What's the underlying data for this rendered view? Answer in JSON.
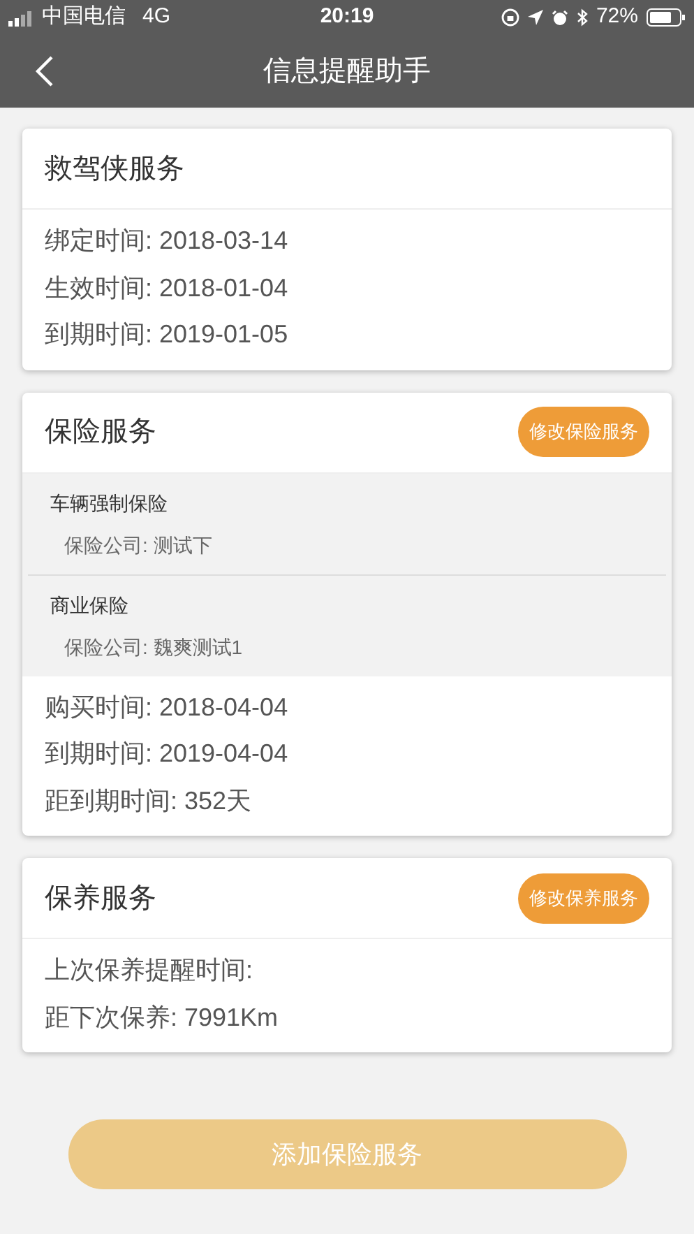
{
  "status_bar": {
    "carrier": "中国电信",
    "network": "4G",
    "time": "20:19",
    "battery": "72%"
  },
  "nav": {
    "title": "信息提醒助手"
  },
  "cards": [
    {
      "title": "救驾侠服务",
      "lines": [
        "绑定时间: 2018-03-14",
        "生效时间: 2018-01-04",
        "到期时间: 2019-01-05"
      ]
    },
    {
      "title": "保险服务",
      "action": "修改保险服务",
      "policies": [
        {
          "name": "车辆强制保险",
          "company": "保险公司: 测试下"
        },
        {
          "name": "商业保险",
          "company": "保险公司: 魏爽测试1"
        }
      ],
      "lines": [
        "购买时间: 2018-04-04",
        "到期时间: 2019-04-04",
        "距到期时间: 352天"
      ]
    },
    {
      "title": "保养服务",
      "action": "修改保养服务",
      "lines": [
        "上次保养提醒时间:",
        "距下次保养: 7991Km"
      ]
    }
  ],
  "add_button": "添加保险服务"
}
